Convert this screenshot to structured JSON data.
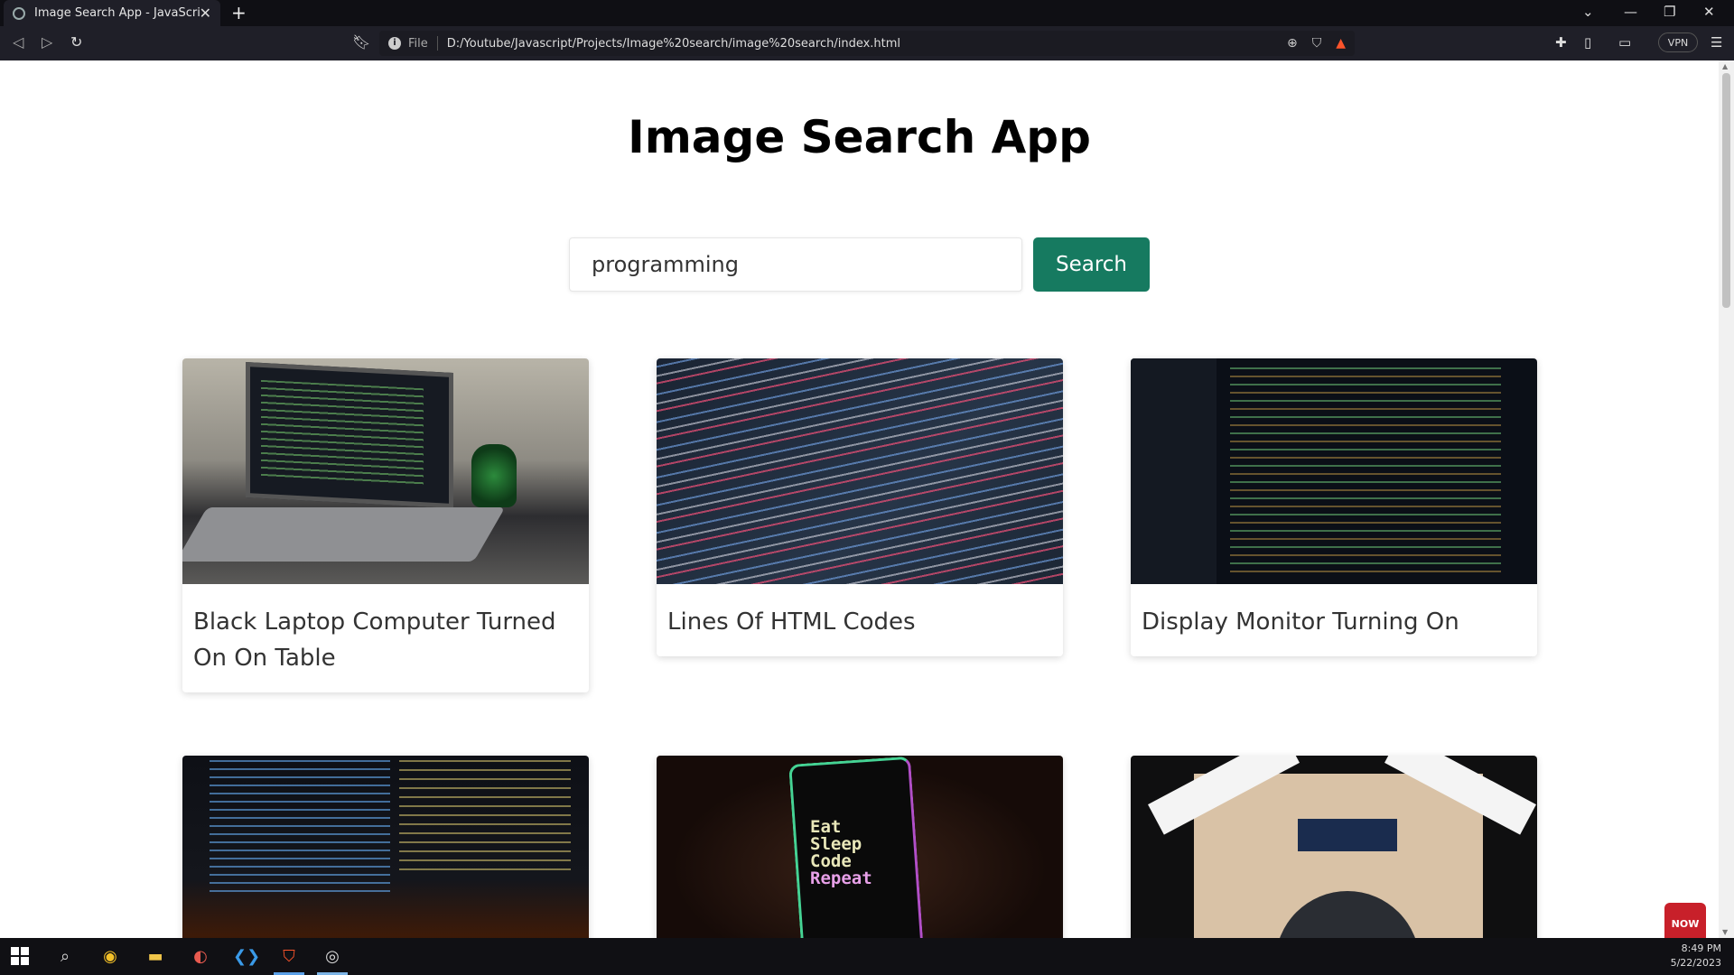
{
  "browser": {
    "tab_title": "Image Search App - JavaScript",
    "tab_close": "✕",
    "new_tab": "+",
    "url_scheme_label": "File",
    "url": "D:/Youtube/Javascript/Projects/Image%20search/image%20search/index.html",
    "vpn_label": "VPN",
    "window_controls": [
      "⌄",
      "—",
      "❐",
      "✕"
    ]
  },
  "page": {
    "title": "Image Search App",
    "search": {
      "value": "programming",
      "button_label": "Search"
    },
    "results": [
      {
        "caption": "Black Laptop Computer Turned On On Table"
      },
      {
        "caption": "Lines Of HTML Codes"
      },
      {
        "caption": "Display Monitor Turning On"
      },
      {
        "caption": ""
      },
      {
        "caption": ""
      },
      {
        "caption": ""
      }
    ],
    "image5_text": [
      "Eat",
      "Sleep",
      "Code",
      "Repeat"
    ]
  },
  "overlay": {
    "subscribe_label": "NOW"
  },
  "taskbar": {
    "time": "8:49 PM",
    "date": "5/22/2023"
  },
  "colors": {
    "accent": "#167a60",
    "chrome_bg": "#1f1f28",
    "taskbar_bg": "#101014"
  }
}
